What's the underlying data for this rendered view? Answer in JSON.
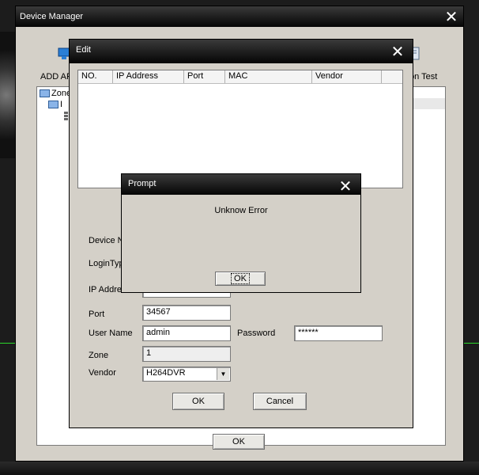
{
  "device_manager": {
    "title": "Device Manager",
    "toolbar_left_label": "ADD AR",
    "toolbar_right_label": "on Test",
    "tree": {
      "root_label": "Zone",
      "child_marker": "I"
    },
    "ok_label": "OK"
  },
  "edit": {
    "title": "Edit",
    "columns": [
      "NO.",
      "IP Address",
      "Port",
      "MAC",
      "Vendor"
    ],
    "form": {
      "device_name_label": "Device Na",
      "login_type_label": "LoginType",
      "ip_address_label": "IP Addres",
      "port_label": "Port",
      "port_value": "34567",
      "user_name_label": "User Name",
      "user_name_value": "admin",
      "password_label": "Password",
      "password_value": "******",
      "zone_label": "Zone",
      "zone_value": "1",
      "vendor_label": "Vendor",
      "vendor_value": "H264DVR"
    },
    "ok_label": "OK",
    "cancel_label": "Cancel"
  },
  "prompt": {
    "title": "Prompt",
    "message": "Unknow Error",
    "ok_label": "OK"
  },
  "colors": {
    "titlebar": "#000000",
    "dialog_body": "#d4d0c8",
    "accent_line": "#2bd82b"
  }
}
